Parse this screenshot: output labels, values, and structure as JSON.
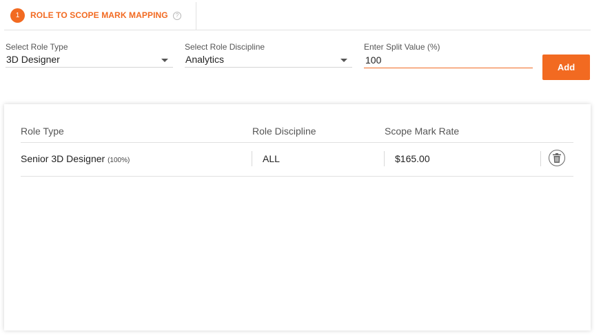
{
  "tab": {
    "step_number": "1",
    "title": "ROLE TO SCOPE MARK MAPPING",
    "help_icon": "question-circle-icon"
  },
  "form": {
    "role_type": {
      "label": "Select Role Type",
      "value": "3D Designer"
    },
    "role_discipline": {
      "label": "Select Role Discipline",
      "value": "Analytics"
    },
    "split_value": {
      "label": "Enter Split Value (%)",
      "value": "100"
    },
    "add_label": "Add"
  },
  "table": {
    "headers": [
      "Role Type",
      "Role Discipline",
      "Scope Mark Rate"
    ],
    "rows": [
      {
        "role_type": "Senior 3D Designer",
        "split": "(100%)",
        "discipline": "ALL",
        "rate": "$165.00",
        "action_icon": "trash-icon"
      }
    ]
  },
  "colors": {
    "accent": "#f26a21"
  }
}
